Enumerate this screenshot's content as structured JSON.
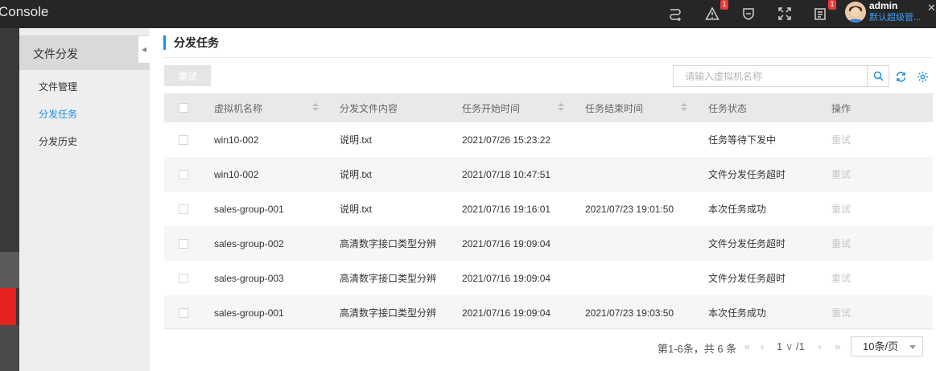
{
  "app": {
    "title": "Console"
  },
  "header": {
    "alert_badge": "1",
    "message_badge": "1",
    "user": {
      "name": "admin",
      "role": "默认超级管..."
    },
    "icons": [
      "task-icon",
      "alert-icon",
      "shield-icon",
      "fullscreen-icon",
      "message-icon",
      "close-icon"
    ]
  },
  "sidebar": {
    "title": "文件分发",
    "items": [
      {
        "label": "文件管理",
        "active": false
      },
      {
        "label": "分发任务",
        "active": true
      },
      {
        "label": "分发历史",
        "active": false
      }
    ]
  },
  "page": {
    "title": "分发任务",
    "retry_label": "重试",
    "search_placeholder": "请输入虚拟机名称"
  },
  "table": {
    "columns": [
      "虚拟机名称",
      "分发文件内容",
      "任务开始时间",
      "任务结束时间",
      "任务状态",
      "操作"
    ],
    "rows": [
      {
        "vm": "win10-002",
        "file": "说明.txt",
        "start": "2021/07/26 15:23:22",
        "end": "",
        "status": "任务等待下发中",
        "op": "重试"
      },
      {
        "vm": "win10-002",
        "file": "说明.txt",
        "start": "2021/07/18 10:47:51",
        "end": "",
        "status": "文件分发任务超时",
        "op": "重试"
      },
      {
        "vm": "sales-group-001",
        "file": "说明.txt",
        "start": "2021/07/16 19:16:01",
        "end": "2021/07/23 19:01:50",
        "status": "本次任务成功",
        "op": "重试"
      },
      {
        "vm": "sales-group-002",
        "file": "高清数字接口类型分辨",
        "start": "2021/07/16 19:09:04",
        "end": "",
        "status": "文件分发任务超时",
        "op": "重试"
      },
      {
        "vm": "sales-group-003",
        "file": "高清数字接口类型分辨",
        "start": "2021/07/16 19:09:04",
        "end": "",
        "status": "文件分发任务超时",
        "op": "重试"
      },
      {
        "vm": "sales-group-001",
        "file": "高清数字接口类型分辨",
        "start": "2021/07/16 19:09:04",
        "end": "2021/07/23 19:03:50",
        "status": "本次任务成功",
        "op": "重试"
      }
    ]
  },
  "pagination": {
    "summary": "第1-6条，共 6 条",
    "current": "1",
    "total": "/1",
    "page_size": "10条/页"
  },
  "colors": {
    "accent": "#1e90e0",
    "danger": "#e52121"
  }
}
